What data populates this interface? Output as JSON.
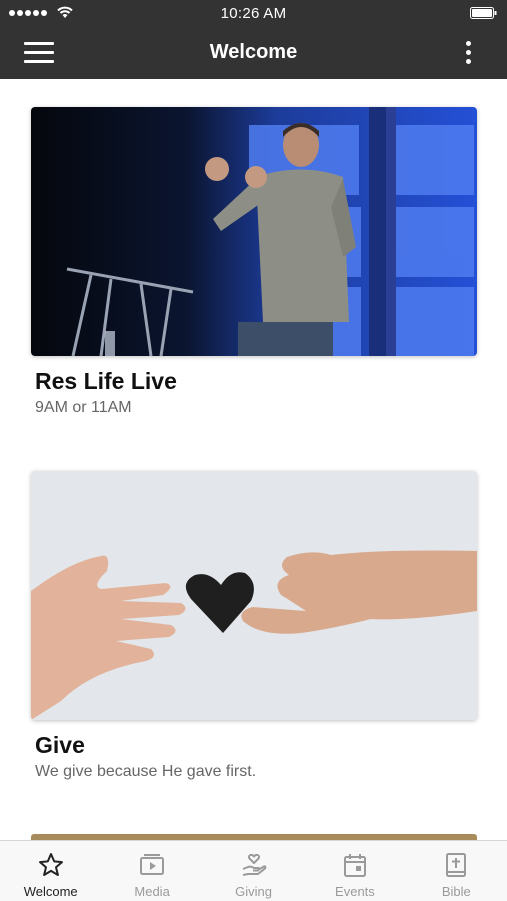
{
  "status_bar": {
    "time": "10:26 AM"
  },
  "nav": {
    "title": "Welcome"
  },
  "cards": [
    {
      "title": "Res Life Live",
      "subtitle": "9AM or 11AM"
    },
    {
      "title": "Give",
      "subtitle": "We give because He gave first."
    }
  ],
  "tabs": [
    {
      "label": "Welcome",
      "icon": "star-icon",
      "active": true
    },
    {
      "label": "Media",
      "icon": "media-icon",
      "active": false
    },
    {
      "label": "Giving",
      "icon": "giving-icon",
      "active": false
    },
    {
      "label": "Events",
      "icon": "calendar-icon",
      "active": false
    },
    {
      "label": "Bible",
      "icon": "bible-icon",
      "active": false
    }
  ],
  "colors": {
    "nav_bar": "#333333",
    "tab_active": "#222222",
    "tab_inactive": "#9a9a9a"
  }
}
